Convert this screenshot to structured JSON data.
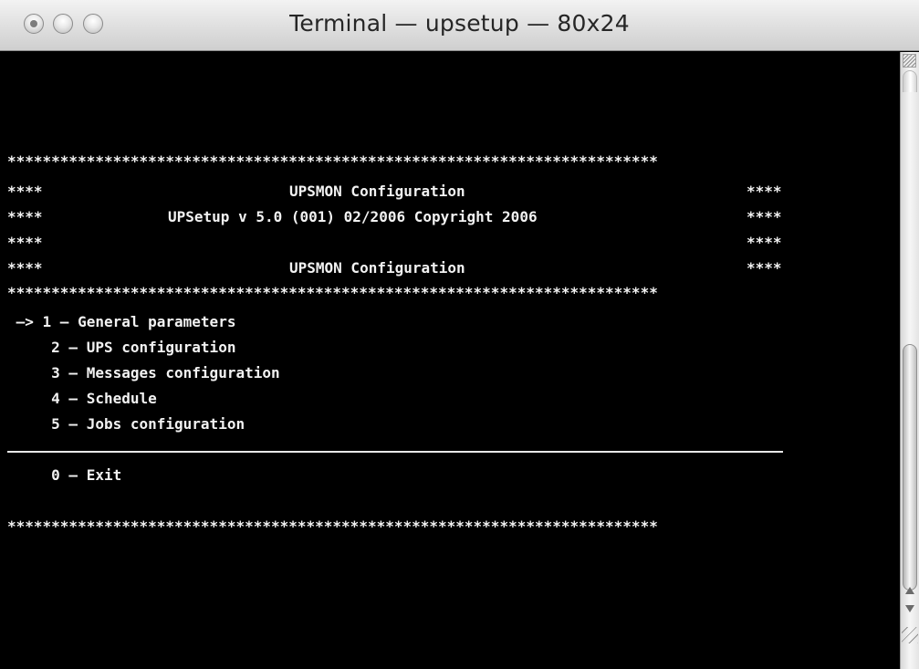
{
  "window": {
    "title": "Terminal — upsetup — 80x24"
  },
  "terminal": {
    "lines": {
      "stars_top": "**************************************************************************",
      "header1_left": "****",
      "header1_center": "UPSMON Configuration",
      "header1_right": "****",
      "header2_left": "****",
      "header2_center": "UPSetup v 5.0 (001) 02/2006 Copyright 2006",
      "header2_right": "****",
      "header3_left": "****",
      "header3_right": "****",
      "header4_left": "****",
      "header4_center": "UPSMON Configuration",
      "header4_right": "****",
      "stars_mid": "**************************************************************************",
      "menu1": " —> 1 — General parameters",
      "menu2": "     2 — UPS configuration",
      "menu3": "     3 — Messages configuration",
      "menu4": "     4 — Schedule",
      "menu5": "     5 — Jobs configuration",
      "exit": "     0 — Exit",
      "stars_bottom": "**************************************************************************"
    }
  },
  "icons": {
    "close": "close-icon",
    "minimize": "minimize-icon",
    "zoom": "zoom-icon",
    "scroll_up": "scroll-up-arrow-icon",
    "scroll_down": "scroll-down-arrow-icon",
    "resize": "resize-grip-icon"
  }
}
